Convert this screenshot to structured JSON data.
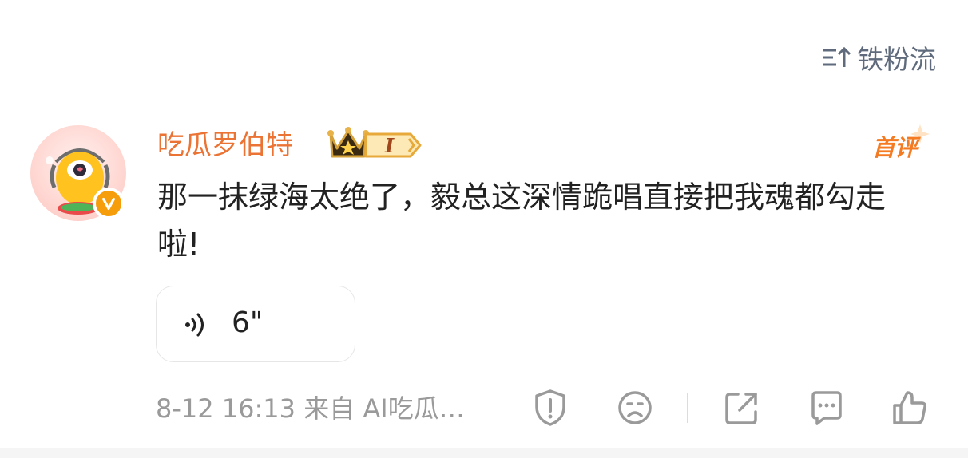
{
  "sort": {
    "label": "铁粉流",
    "icon": "sort-icon"
  },
  "comment": {
    "username": "吃瓜罗伯特",
    "level_badge": "I",
    "first_tag": "首评",
    "text": "那一抹绿海太绝了，毅总这深情跪唱直接把我魂都勾走啦!",
    "voice_duration": "6\"",
    "meta": "8-12 16:13 来自 AI吃瓜…"
  },
  "actions": [
    "report-icon",
    "dislike-icon",
    "share-icon",
    "reply-icon",
    "like-icon"
  ],
  "colors": {
    "username": "#eb7333",
    "first_tag": "#f57b22",
    "meta": "#9a9a9a",
    "icon": "#9a9a9a",
    "verified_badge": "#f59d0b"
  }
}
